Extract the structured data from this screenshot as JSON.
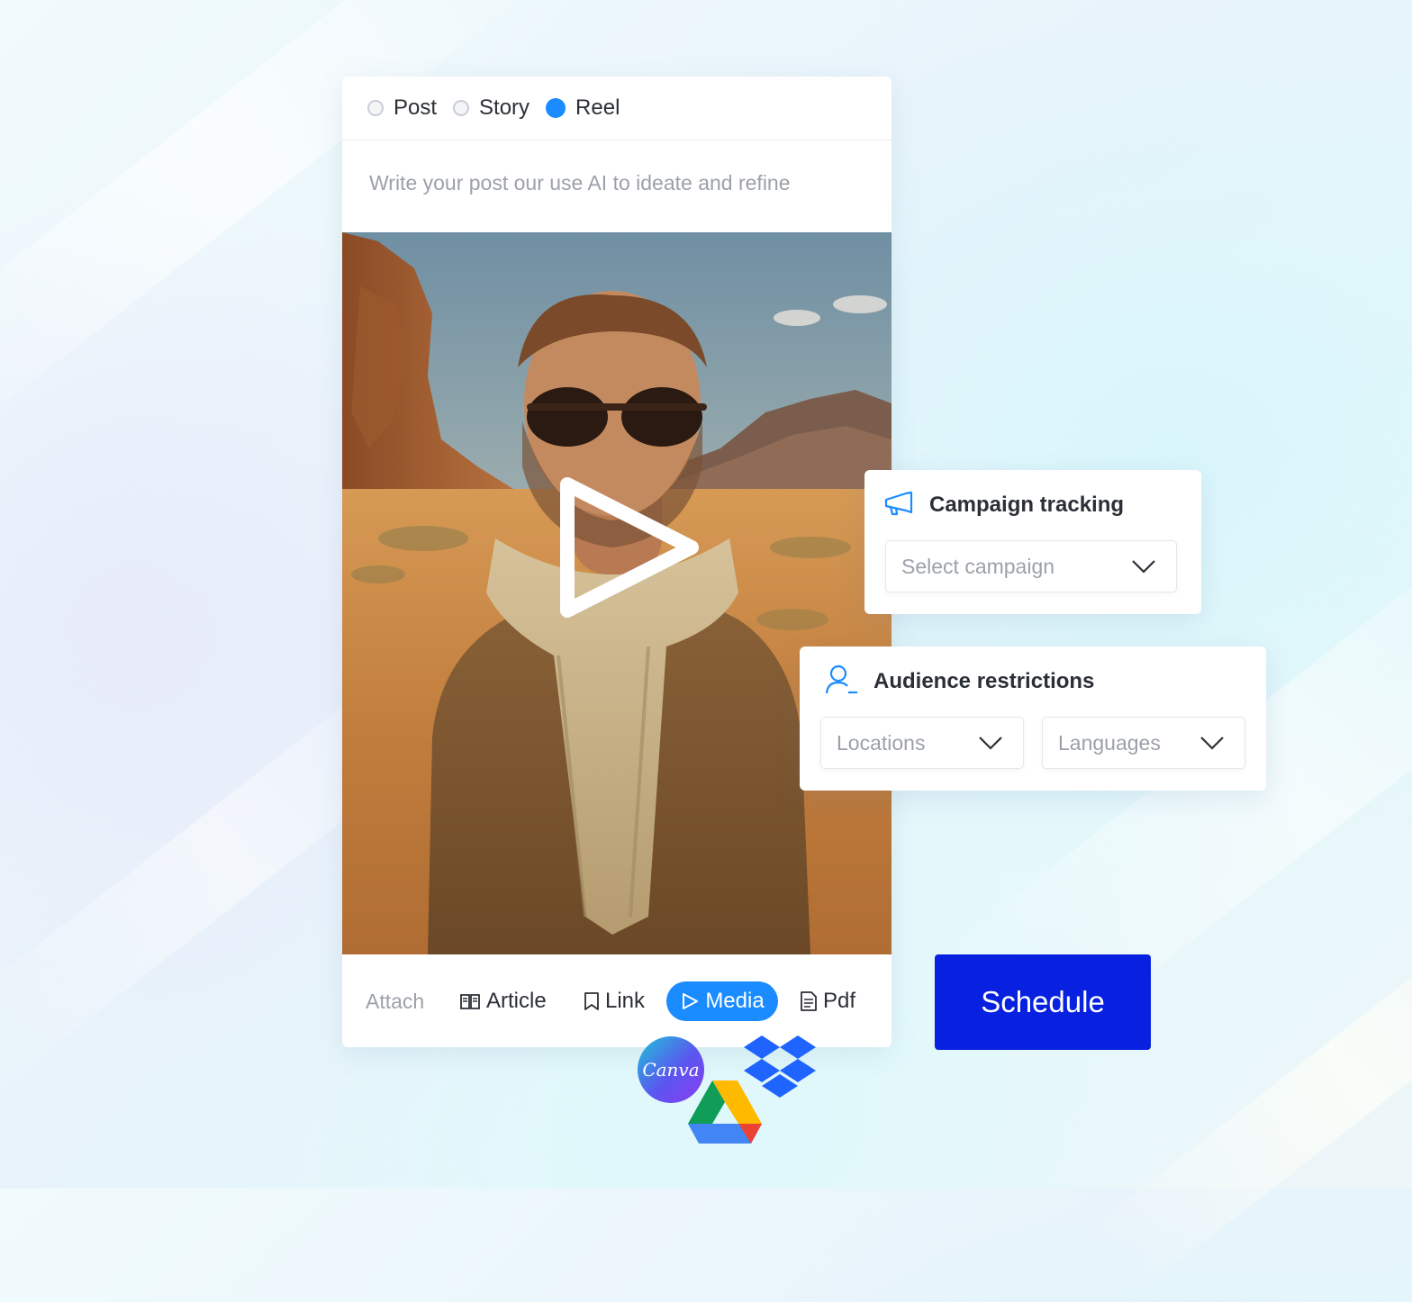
{
  "post_types": {
    "post": "Post",
    "story": "Story",
    "reel": "Reel",
    "selected": "Reel"
  },
  "composer": {
    "placeholder": "Write your post our use AI to ideate and refine"
  },
  "attach": {
    "label": "Attach",
    "article": "Article",
    "link": "Link",
    "media": "Media",
    "pdf": "Pdf",
    "active": "Media"
  },
  "campaign": {
    "title": "Campaign tracking",
    "select_placeholder": "Select campaign"
  },
  "audience": {
    "title": "Audience restrictions",
    "locations_placeholder": "Locations",
    "languages_placeholder": "Languages"
  },
  "schedule_label": "Schedule",
  "integrations": {
    "canva_label": "Canva",
    "items": [
      "canva-logo",
      "google-drive-logo",
      "dropbox-logo"
    ]
  },
  "colors": {
    "accent": "#1a8cff",
    "schedule_button": "#0821e0",
    "placeholder_text": "#9ca1a9"
  }
}
